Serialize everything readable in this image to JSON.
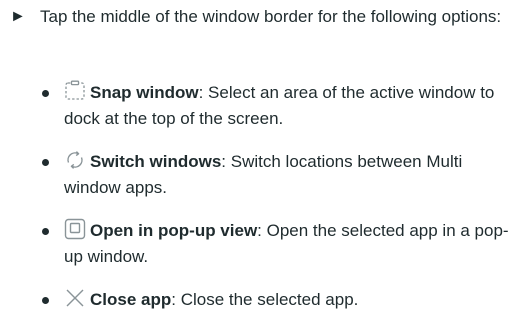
{
  "intro": {
    "arrow_glyph": "►",
    "text": "Tap the middle of the window border for the following options:"
  },
  "options": [
    {
      "icon": "snap-window-icon",
      "term": "Snap window",
      "description": ": Select an area of the active window to dock at the top of the screen."
    },
    {
      "icon": "switch-windows-icon",
      "term": "Switch windows",
      "description": ": Switch locations between Multi window apps."
    },
    {
      "icon": "popup-view-icon",
      "term": "Open in pop-up view",
      "description": ": Open the selected app in a pop-up window."
    },
    {
      "icon": "close-app-icon",
      "term": "Close app",
      "description": ": Close the selected app."
    }
  ]
}
